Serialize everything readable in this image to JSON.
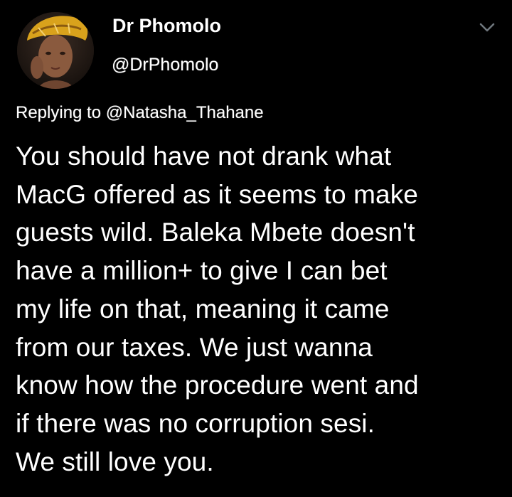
{
  "tweet": {
    "author": {
      "display_name": "Dr Phomolo",
      "handle": "@DrPhomolo",
      "avatar_icon": "profile-photo"
    },
    "menu_icon": "chevron-down-icon",
    "reply": {
      "prefix": "Replying to ",
      "mention": "@Natasha_Thahane"
    },
    "body_lines": [
      "You should have not drank what",
      "MacG offered as it seems to make",
      "guests wild. Baleka Mbete doesn't",
      "have a million+ to give I can bet",
      "my life on that, meaning it came",
      "from our taxes. We just wanna",
      "know how the procedure went and",
      "if there was no corruption sesi.",
      "We still love you."
    ]
  },
  "colors": {
    "background": "#000000",
    "text": "#ffffff",
    "chevron": "#6e767d"
  }
}
